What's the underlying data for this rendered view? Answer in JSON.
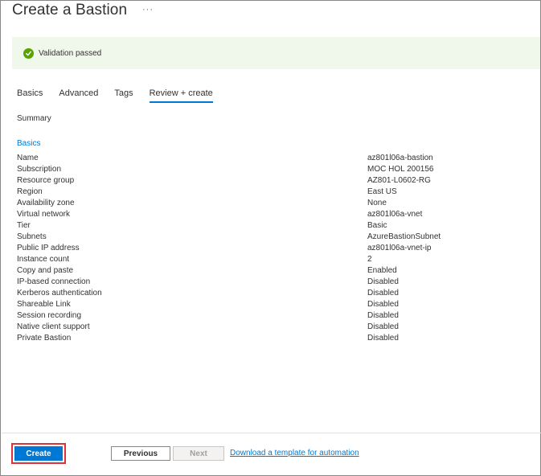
{
  "header": {
    "title": "Create a Bastion",
    "more_label": "···"
  },
  "banner": {
    "status_icon": "check-circle-icon",
    "text": "Validation passed",
    "color": "#57a300"
  },
  "tabs": [
    {
      "label": "Basics",
      "active": false
    },
    {
      "label": "Advanced",
      "active": false
    },
    {
      "label": "Tags",
      "active": false
    },
    {
      "label": "Review + create",
      "active": true
    }
  ],
  "summary": {
    "heading": "Summary",
    "section": "Basics",
    "rows": [
      {
        "key": "Name",
        "value": "az801l06a-bastion"
      },
      {
        "key": "Subscription",
        "value": "MOC HOL 200156"
      },
      {
        "key": "Resource group",
        "value": "AZ801-L0602-RG"
      },
      {
        "key": "Region",
        "value": "East US"
      },
      {
        "key": "Availability zone",
        "value": "None"
      },
      {
        "key": "Virtual network",
        "value": "az801l06a-vnet"
      },
      {
        "key": "Tier",
        "value": "Basic"
      },
      {
        "key": "Subnets",
        "value": "AzureBastionSubnet"
      },
      {
        "key": "Public IP address",
        "value": "az801l06a-vnet-ip"
      },
      {
        "key": "Instance count",
        "value": "2"
      },
      {
        "key": "Copy and paste",
        "value": "Enabled"
      },
      {
        "key": "IP-based connection",
        "value": "Disabled"
      },
      {
        "key": "Kerberos authentication",
        "value": "Disabled"
      },
      {
        "key": "Shareable Link",
        "value": "Disabled"
      },
      {
        "key": "Session recording",
        "value": "Disabled"
      },
      {
        "key": "Native client support",
        "value": "Disabled"
      },
      {
        "key": "Private Bastion",
        "value": "Disabled"
      }
    ]
  },
  "footer": {
    "create_label": "Create",
    "previous_label": "Previous",
    "next_label": "Next",
    "download_link": "Download a template for automation"
  },
  "colors": {
    "accent": "#0078d4",
    "highlight_outline": "#e0303a",
    "banner_bg": "#f0f8ec"
  }
}
